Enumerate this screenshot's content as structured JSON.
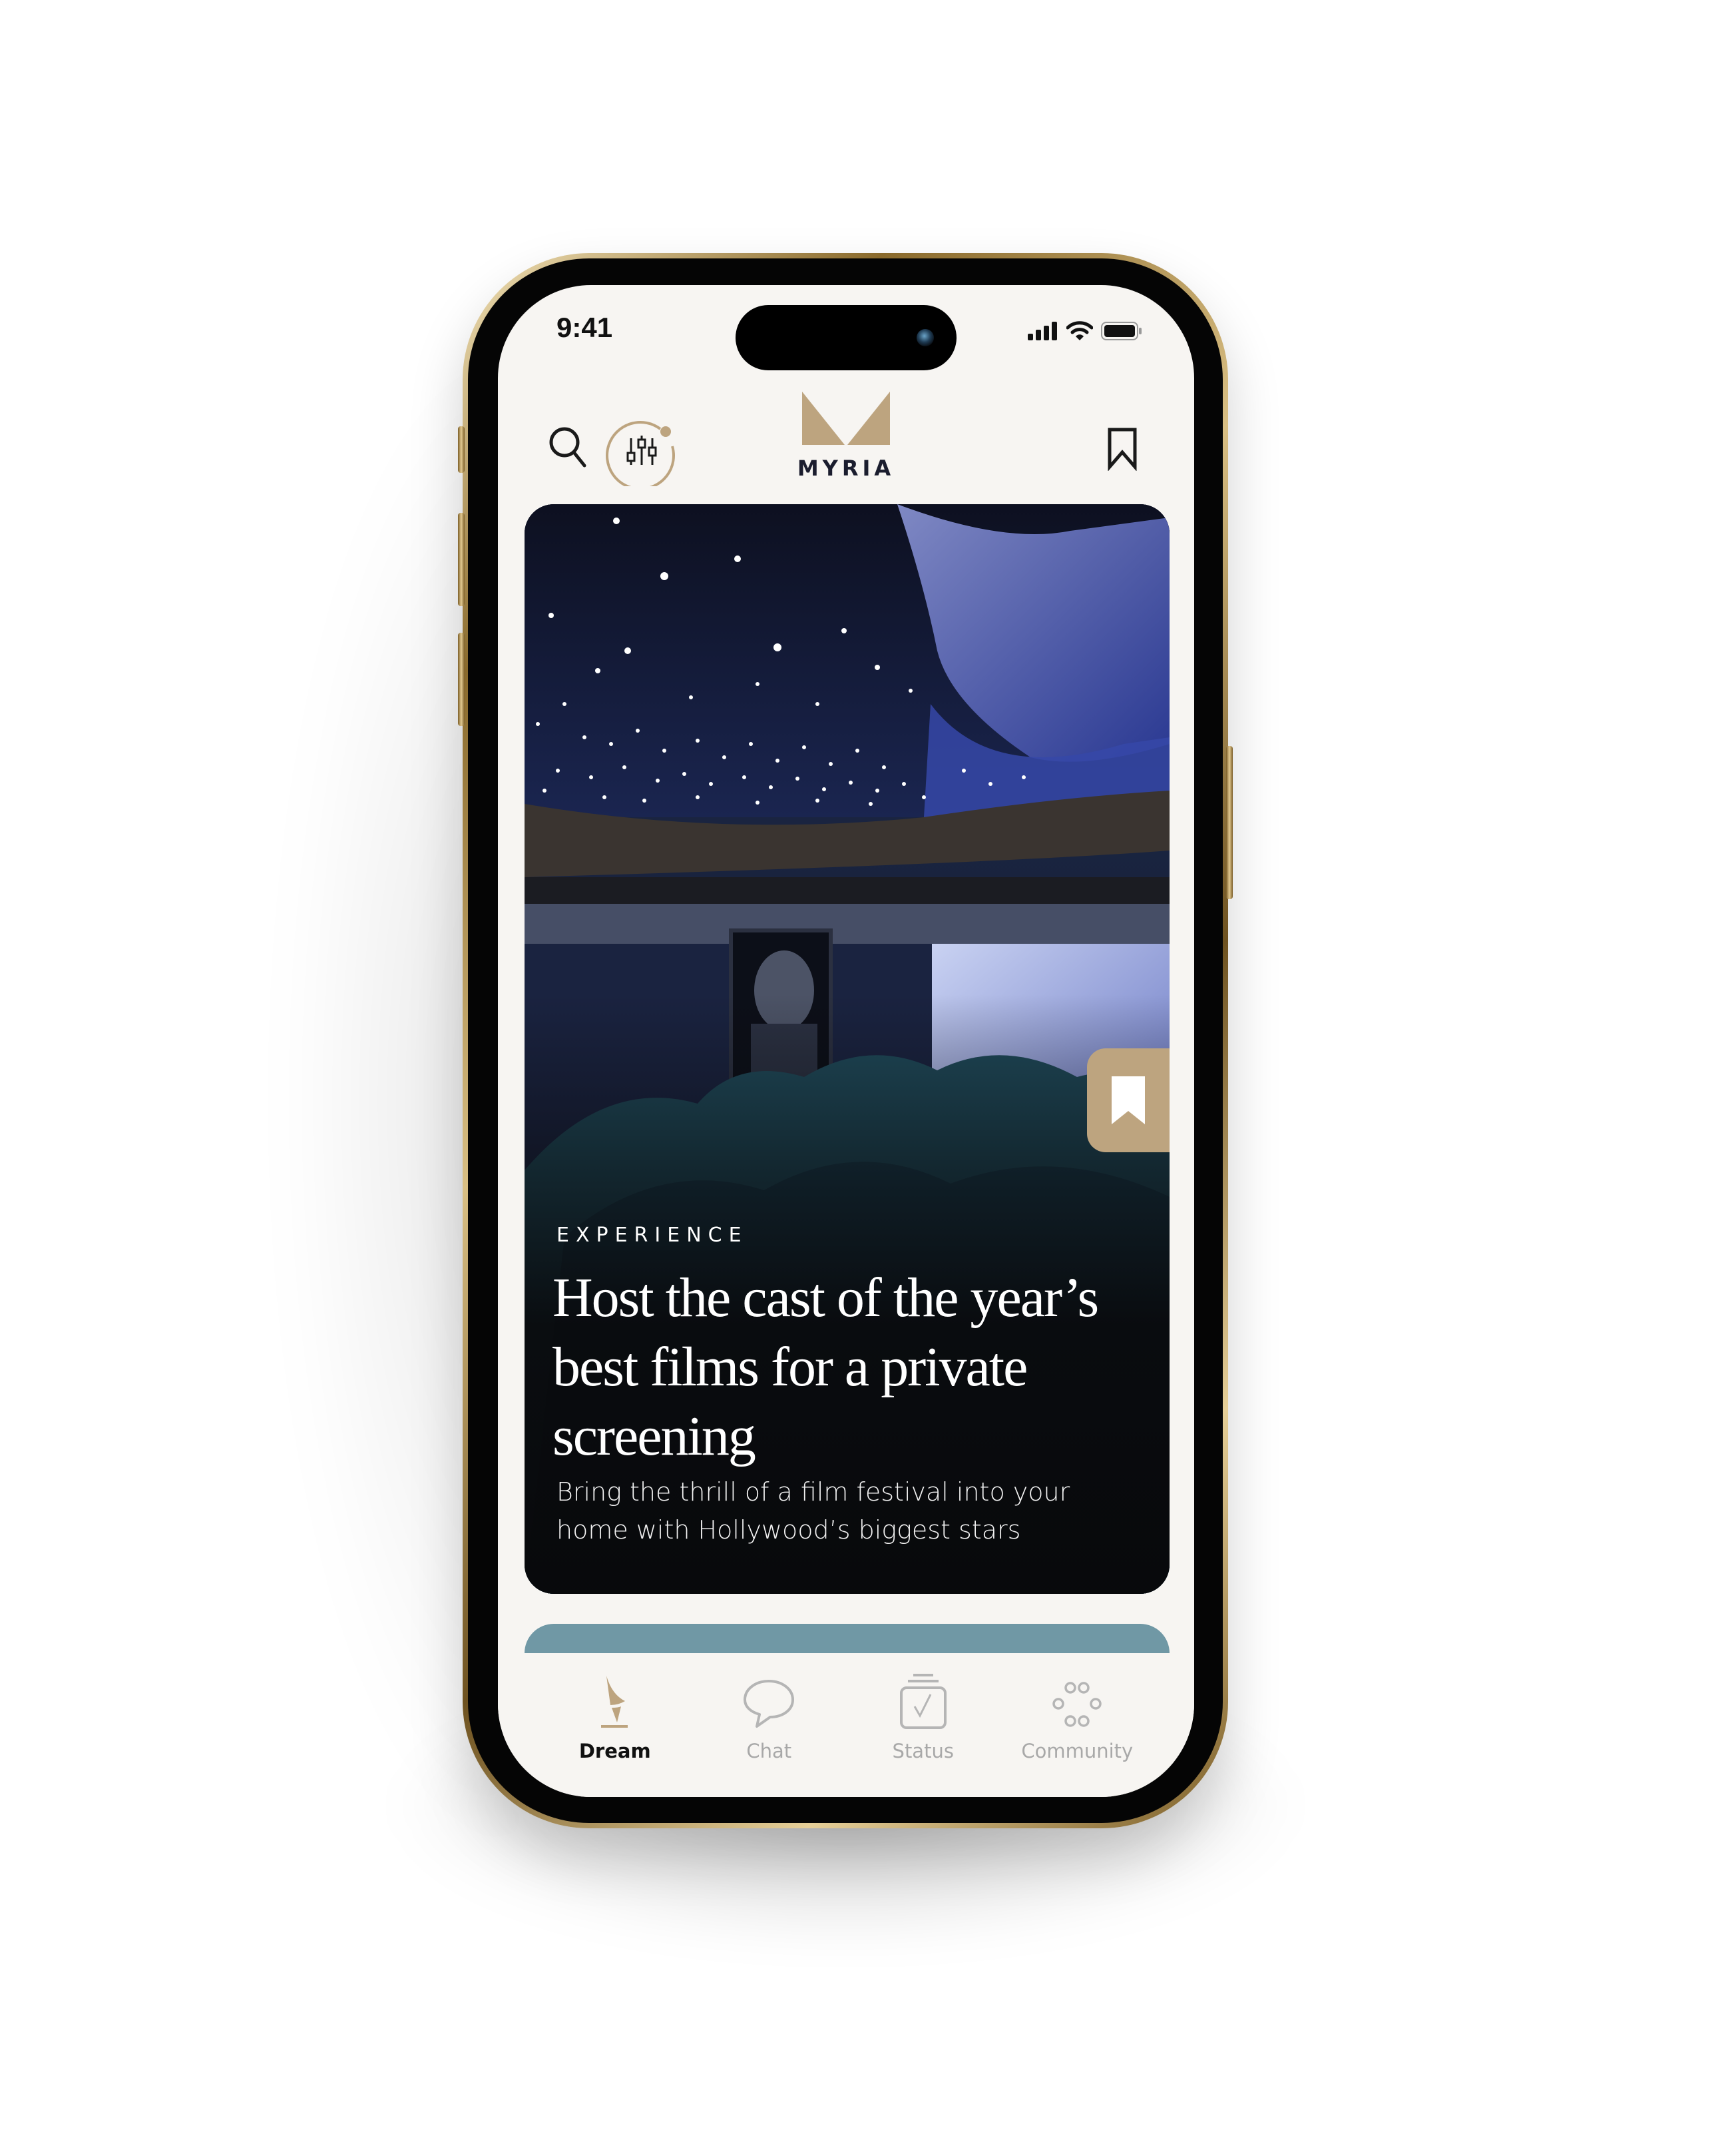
{
  "status_bar": {
    "time": "9:41",
    "icons": [
      "cellular-signal-icon",
      "wifi-icon",
      "battery-icon"
    ]
  },
  "header": {
    "search_icon": "search-icon",
    "filter_icon": "sliders-icon",
    "logo_text": "MYRIA",
    "bookmark_icon": "bookmark-icon"
  },
  "colors": {
    "brand_gold": "#bda47f",
    "background": "#f7f5f2",
    "next_card": "#7098a5",
    "inactive_tab": "#a8a8a8",
    "logo_text": "#1b1d2e"
  },
  "feature_card": {
    "category": "EXPERIENCE",
    "title": "Host the cast of the year’s best films for a private screening",
    "subtitle": "Bring the thrill of a film festival into your home with Hollywood’s biggest stars",
    "image_description": "private home cinema with starlit ceiling, teal velvet seats, framed portrait and projection screen",
    "bookmark_icon": "bookmark-filled-icon"
  },
  "tabbar": {
    "tabs": [
      {
        "label": "Dream",
        "icon": "dream-sail-icon",
        "active": true
      },
      {
        "label": "Chat",
        "icon": "chat-bubble-icon",
        "active": false
      },
      {
        "label": "Status",
        "icon": "status-checklist-icon",
        "active": false
      },
      {
        "label": "Community",
        "icon": "community-circles-icon",
        "active": false
      }
    ]
  }
}
